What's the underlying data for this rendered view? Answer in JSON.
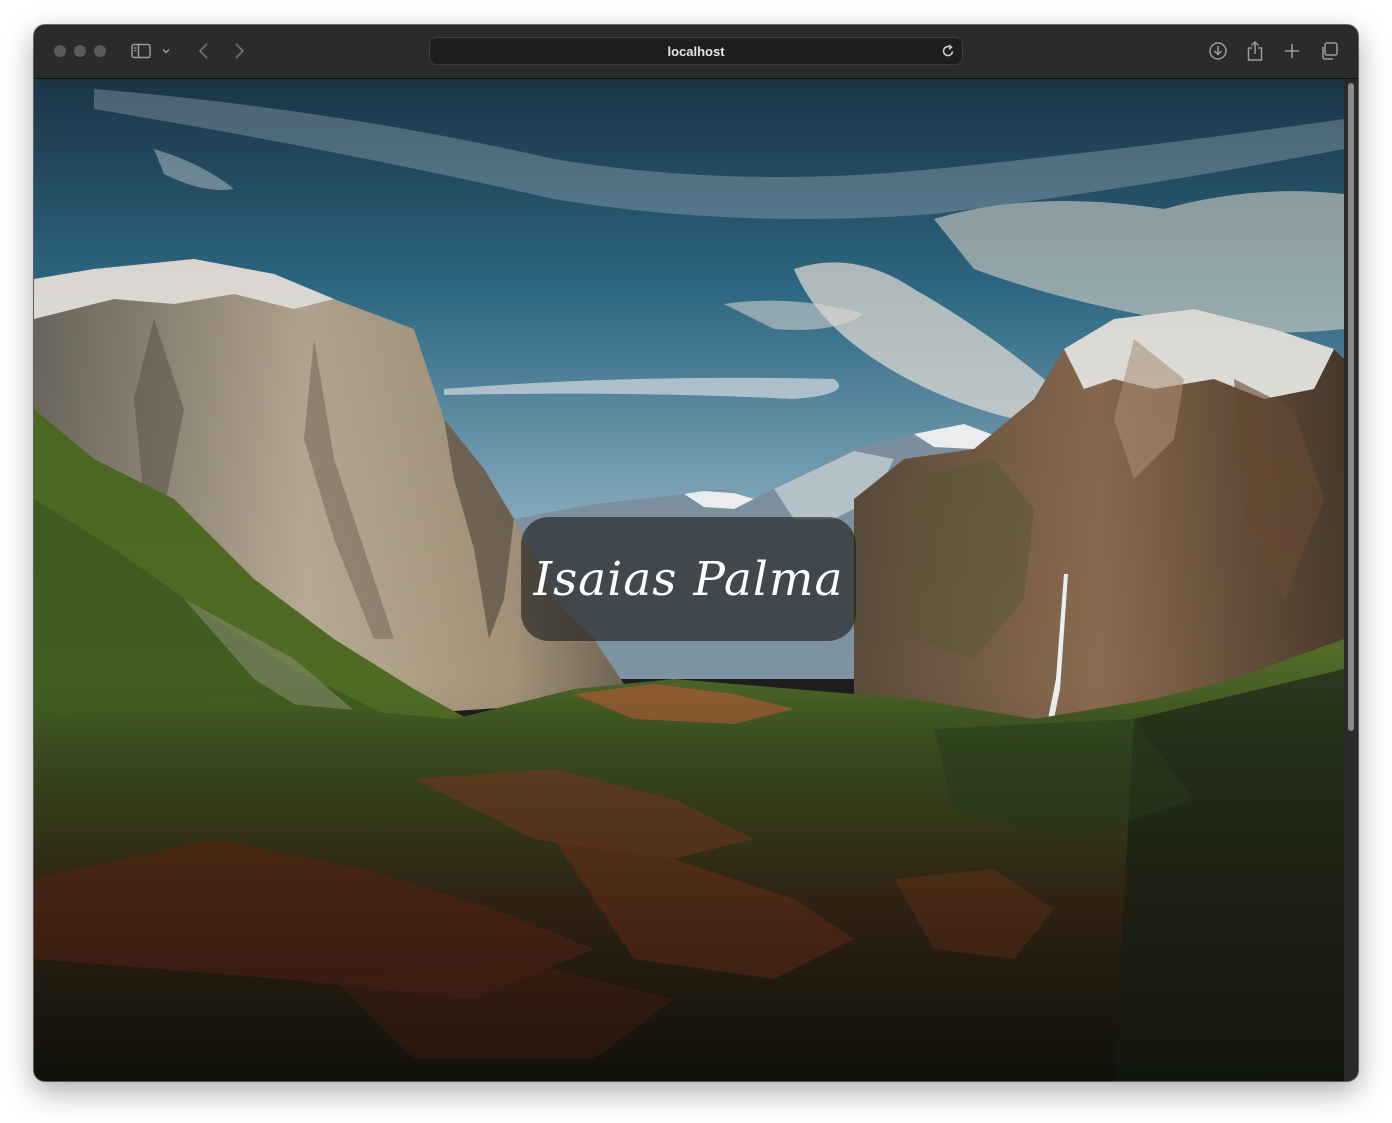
{
  "browser": {
    "url": "localhost",
    "icons": {
      "sidebar": "sidebar-icon",
      "sidebar_menu": "chevron-down-icon",
      "back": "chevron-left-icon",
      "forward": "chevron-right-icon",
      "reload": "reload-icon",
      "download": "download-icon",
      "share": "share-icon",
      "new_tab": "plus-icon",
      "tab_overview": "tabs-icon"
    }
  },
  "page": {
    "name": "Isaias Palma",
    "background_image": "Yosemite valley landscape with granite cliffs, snowy peaks, waterfall and forest"
  },
  "colors": {
    "toolbar": "#2b2b29",
    "name_card": "rgba(28,28,28,0.62)",
    "name_text": "#ffffff"
  }
}
